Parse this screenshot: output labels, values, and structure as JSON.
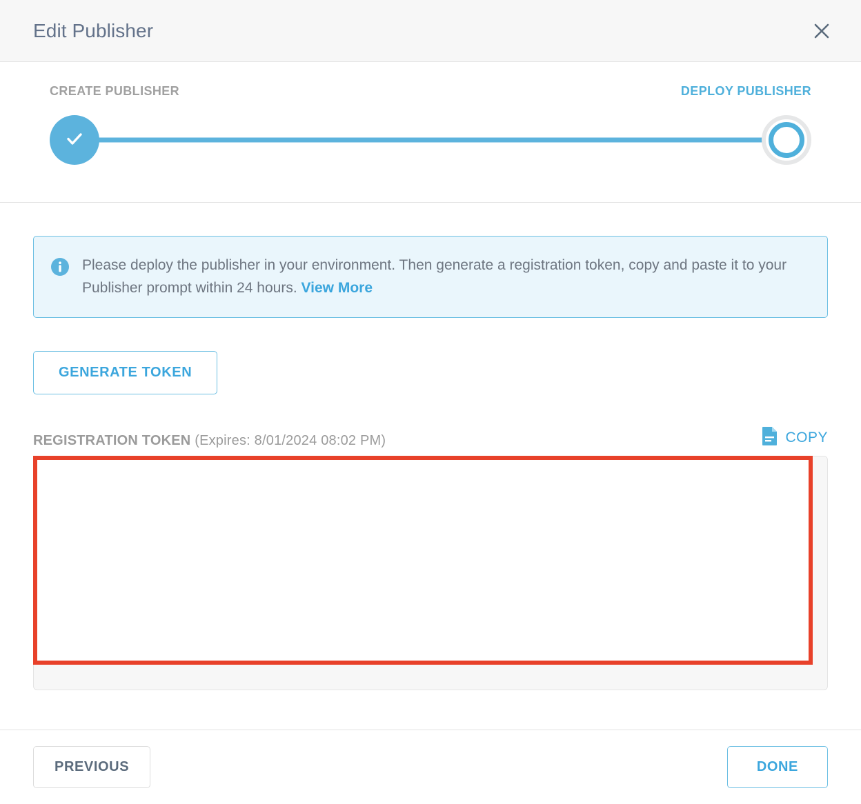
{
  "header": {
    "title": "Edit Publisher",
    "close_icon": "close-icon"
  },
  "stepper": {
    "steps": [
      {
        "label": "CREATE PUBLISHER",
        "state": "completed",
        "icon": "check-icon"
      },
      {
        "label": "DEPLOY PUBLISHER",
        "state": "active",
        "icon": "circle-icon"
      }
    ]
  },
  "info_banner": {
    "icon": "info-icon",
    "text": "Please deploy the publisher in your environment. Then generate a registration token, copy and paste it to your Publisher prompt within 24 hours.",
    "link_label": "View More"
  },
  "actions": {
    "generate_token_label": "GENERATE TOKEN"
  },
  "token": {
    "label_main": "REGISTRATION TOKEN",
    "label_expiry": "(Expires: 8/01/2024 08:02 PM)",
    "value": "",
    "placeholder": "",
    "copy_label": "COPY",
    "copy_icon": "copy-file-icon"
  },
  "footer": {
    "previous_label": "PREVIOUS",
    "done_label": "DONE"
  },
  "colors": {
    "accent_blue": "#4fb0db",
    "link_blue": "#3ba6dd",
    "banner_bg": "#eaf6fc",
    "banner_border": "#6cbfe3",
    "highlight_red": "#e8412a",
    "header_bg": "#f7f7f7",
    "muted_text": "#9b9b9b",
    "body_text": "#5b6b7c"
  }
}
